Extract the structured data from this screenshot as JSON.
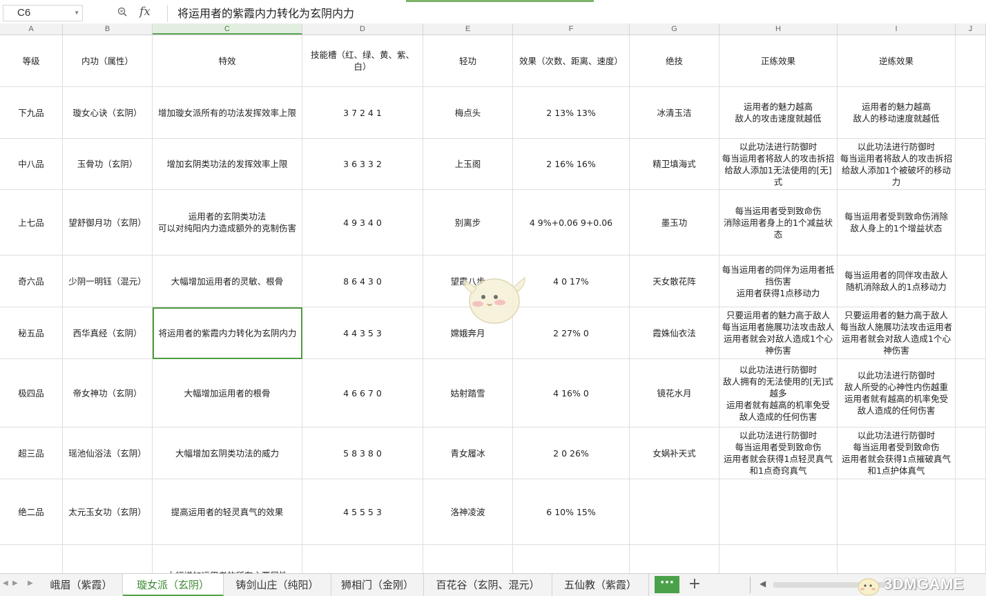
{
  "name_box": "C6",
  "fx_label": "fx",
  "formula_value": "将运用者的紫霞内力转化为玄阴内力",
  "columns": [
    "A",
    "B",
    "C",
    "D",
    "E",
    "F",
    "G",
    "H",
    "I",
    "J"
  ],
  "rows": [
    [
      "等级",
      "内功（属性）",
      "特效",
      "技能槽（红、绿、黄、紫、白）",
      "轻功",
      "效果（次数、距离、速度）",
      "绝技",
      "正练效果",
      "逆练效果",
      ""
    ],
    [
      "下九品",
      "璇女心诀（玄阴）",
      "增加璇女派所有的功法发挥效率上限",
      "3  7  2  4  1",
      "梅点头",
      "2  13%  13%",
      "冰清玉洁",
      "运用者的魅力越高\n敌人的攻击速度就越低",
      "运用者的魅力越高\n敌人的移动速度就越低",
      ""
    ],
    [
      "中八品",
      "玉骨功（玄阴）",
      "增加玄阴类功法的发挥效率上限",
      "3  6  3  3  2",
      "上玉阁",
      "2  16%  16%",
      "精卫填海式",
      "以此功法进行防御时\n每当运用者将敌人的攻击拆招\n给敌人添加1无法使用的[无]式",
      "以此功法进行防御时\n每当运用者将敌人的攻击拆招\n给敌人添加1个被破坏的移动力",
      ""
    ],
    [
      "上七品",
      "望舒御月功（玄阴）",
      "运用者的玄阴类功法\n可以对纯阳内力造成额外的克制伤害",
      "4  9  3  4  0",
      "别离步",
      "4  9%+0.06  9+0.06",
      "墨玉功",
      "每当运用者受到致命伤\n消除运用者身上的1个减益状态",
      "每当运用者受到致命伤消除\n敌人身上的1个增益状态",
      ""
    ],
    [
      "奇六品",
      "少阴一明钰（混元）",
      "大幅增加运用者的灵敏、根骨",
      "8  6  4  3  0",
      "望霞八步",
      "4  0  17%",
      "天女散花阵",
      "每当运用者的同伴为运用者抵挡伤害\n运用者获得1点移动力",
      "每当运用者的同伴攻击敌人\n随机消除敌人的1点移动力",
      ""
    ],
    [
      "秘五品",
      "西华真经（玄阴）",
      "将运用者的紫霞内力转化为玄阴内力",
      "4  4  3  5  3",
      "嫦娥奔月",
      "2  27%  0",
      "霞姝仙衣法",
      "只要运用者的魅力高于敌人\n每当运用者施展功法攻击敌人\n运用者就会对敌人造成1个心神伤害",
      "只要运用者的魅力高于敌人\n每当敌人施展功法攻击运用者\n运用者就会对敌人造成1个心神伤害",
      ""
    ],
    [
      "极四品",
      "帝女神功（玄阴）",
      "大幅增加运用者的根骨",
      "4  6  6  7  0",
      "姑射踏雪",
      "4  16%  0",
      "镜花水月",
      "以此功法进行防御时\n敌人拥有的无法使用的[无]式越多\n运用者就有越高的机率免受\n敌人造成的任何伤害",
      "以此功法进行防御时\n敌人所受的心神性内伤越重\n运用者就有越高的机率免受\n敌人造成的任何伤害",
      ""
    ],
    [
      "超三品",
      "瑶池仙浴法（玄阴）",
      "大幅增加玄阴类功法的威力",
      "5  8  3  8  0",
      "青女履冰",
      "2  0  26%",
      "女娲补天式",
      "以此功法进行防御时\n每当运用者受到致命伤\n运用者就会获得1点轻灵真气\n和1点奇窍真气",
      "以此功法进行防御时\n每当运用者受到致命伤\n运用者就会获得1点摧破真气\n和1点护体真气",
      ""
    ],
    [
      "绝二品",
      "太元玉女功（玄阴）",
      "提高运用者的轻灵真气的效果",
      "4  5  5  5  3",
      "洛神凌波",
      "6  10%  15%",
      "",
      "",
      "",
      ""
    ],
    [
      "",
      "",
      "大幅增加运用者的所有主要属性",
      "",
      "",
      "",
      "",
      "",
      "",
      ""
    ]
  ],
  "sheet_tabs": [
    "峨眉（紫霞）",
    "璇女派（玄阴）",
    "铸剑山庄（纯阳）",
    "狮相门（金刚）",
    "百花谷（玄阴、混元）",
    "五仙教（紫霞）"
  ],
  "active_tab": "璇女派（玄阴）",
  "more_button": "···",
  "add_button": "+",
  "watermark": "3DMGAME",
  "colors": {
    "accent": "#4aa14a",
    "active_border": "#4e9a3f"
  }
}
